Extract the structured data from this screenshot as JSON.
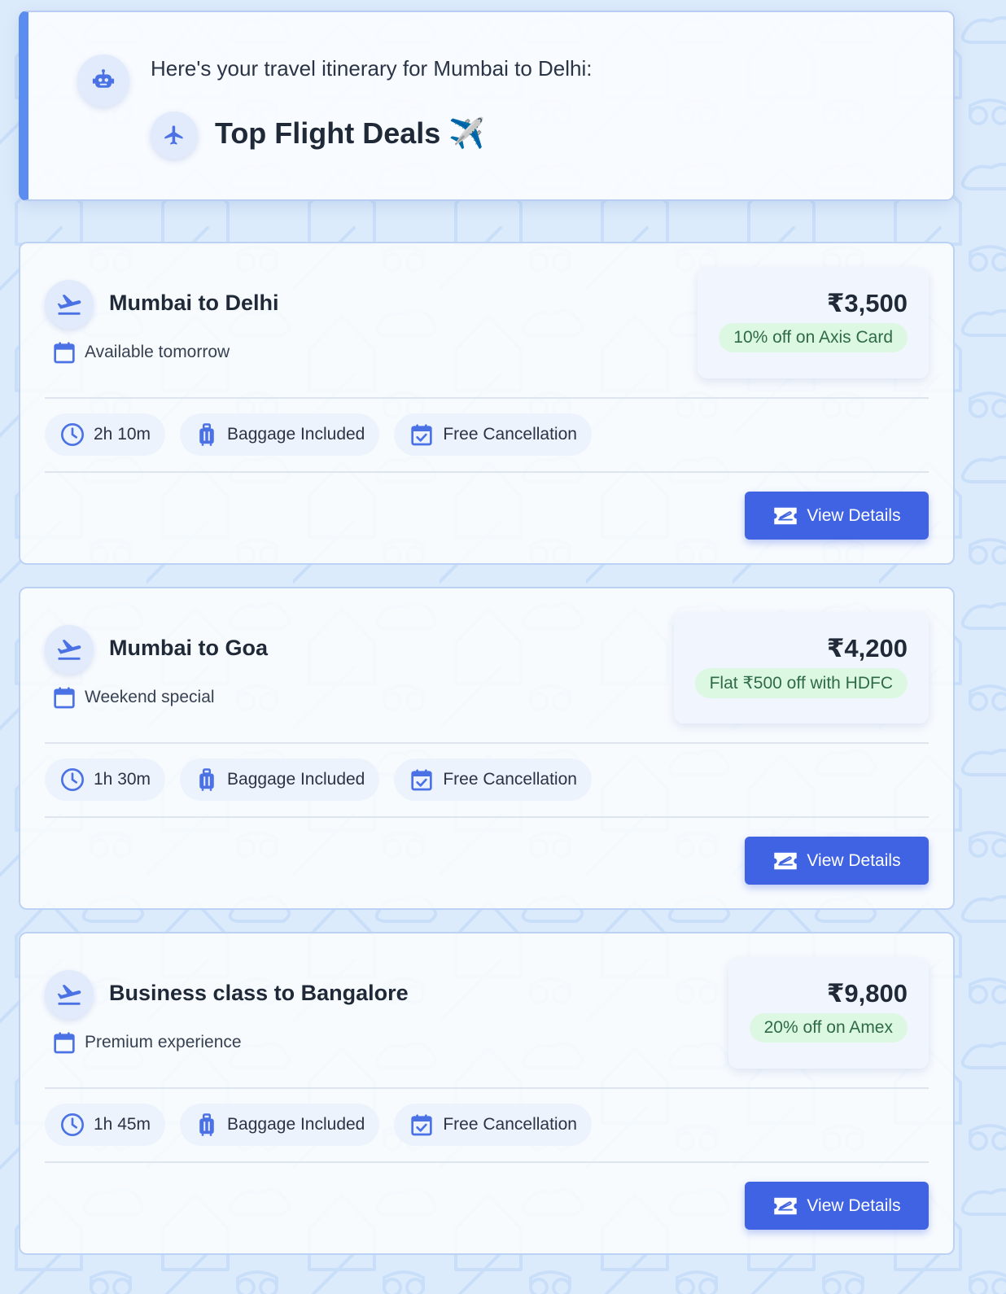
{
  "header": {
    "intro": "Here's your travel itinerary for Mumbai to Delhi:",
    "title": "Top Flight Deals ✈️"
  },
  "icons": {
    "avatar": "robot-icon",
    "title": "airplane-icon",
    "route": "flight-takeoff-icon",
    "subtitle": "calendar-icon",
    "duration": "clock-icon",
    "baggage": "luggage-icon",
    "cancellation": "calendar-check-icon",
    "button": "ticket-icon"
  },
  "colors": {
    "accent": "#3f63e3",
    "icon": "#4a72e4",
    "offer_bg": "#dcf8e3",
    "offer_text": "#2e6b44",
    "page_bg": "#dcebfb"
  },
  "flights": [
    {
      "route": "Mumbai to Delhi",
      "subtitle": "Available tomorrow",
      "price": "₹3,500",
      "offer": "10% off on Axis Card",
      "duration": "2h 10m",
      "baggage": "Baggage Included",
      "cancellation": "Free Cancellation",
      "button": "View Details"
    },
    {
      "route": "Mumbai to Goa",
      "subtitle": "Weekend special",
      "price": "₹4,200",
      "offer": "Flat ₹500 off with HDFC",
      "duration": "1h 30m",
      "baggage": "Baggage Included",
      "cancellation": "Free Cancellation",
      "button": "View Details"
    },
    {
      "route": "Business class to Bangalore",
      "subtitle": "Premium experience",
      "price": "₹9,800",
      "offer": "20% off on Amex",
      "duration": "1h 45m",
      "baggage": "Baggage Included",
      "cancellation": "Free Cancellation",
      "button": "View Details"
    }
  ]
}
